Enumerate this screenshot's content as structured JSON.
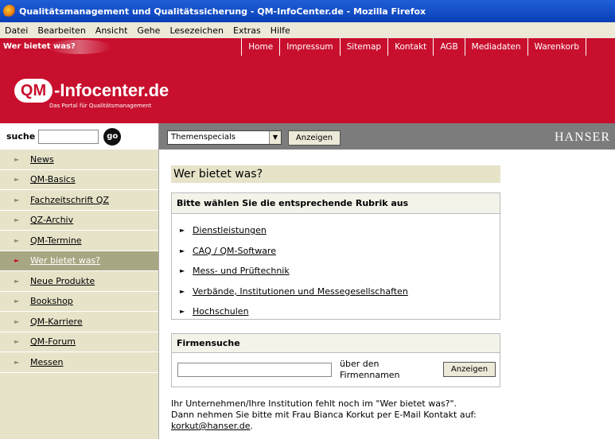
{
  "window": {
    "title": "Qualitätsmanagement und Qualitätssicherung - QM-InfoCenter.de - Mozilla Firefox"
  },
  "menubar": {
    "items": [
      "Datei",
      "Bearbeiten",
      "Ansicht",
      "Gehe",
      "Lesezeichen",
      "Extras",
      "Hilfe"
    ]
  },
  "site_header": {
    "tagline": "Wer bietet was?",
    "nav": [
      "Home",
      "Impressum",
      "Sitemap",
      "Kontakt",
      "AGB",
      "Mediadaten",
      "Warenkorb"
    ]
  },
  "logo": {
    "mark": "QM",
    "name": "-Infocenter.de",
    "subtitle": "Das Portal für Qualitätsmanagement"
  },
  "search": {
    "label": "suche",
    "value": "",
    "go_label": "go"
  },
  "toolbar": {
    "select_value": "Themenspecials",
    "show_button": "Anzeigen",
    "brand": "HANSER"
  },
  "sidebar": {
    "items": [
      {
        "label": "News",
        "active": false
      },
      {
        "label": "QM-Basics",
        "active": false
      },
      {
        "label": "Fachzeitschrift QZ",
        "active": false
      },
      {
        "label": "QZ-Archiv",
        "active": false
      },
      {
        "label": "QM-Termine",
        "active": false
      },
      {
        "label": "Wer bietet was?",
        "active": true
      },
      {
        "label": "Neue Produkte",
        "active": false
      },
      {
        "label": "Bookshop",
        "active": false
      },
      {
        "label": "QM-Karriere",
        "active": false
      },
      {
        "label": "QM-Forum",
        "active": false
      },
      {
        "label": "Messen",
        "active": false
      }
    ]
  },
  "main": {
    "title": "Wer bietet was?",
    "rubric_box": {
      "heading": "Bitte wählen Sie die entsprechende Rubrik aus",
      "links": [
        "Dienstleistungen",
        "CAQ / QM-Software",
        "Mess- und Prüftechnik",
        "Verbände, Institutionen und Messegesellschaften",
        "Hochschulen"
      ]
    },
    "firm_search": {
      "heading": "Firmensuche",
      "value": "",
      "hint": "über den Firmennamen",
      "button": "Anzeigen"
    },
    "note": {
      "line1": "Ihr Unternehmen/Ihre Institution fehlt noch im \"Wer bietet was?\".",
      "line2": "Dann nehmen Sie bitte mit Frau Bianca Korkut per E-Mail Kontakt auf:",
      "email": "korkut@hanser.de",
      "trailing": "."
    }
  }
}
